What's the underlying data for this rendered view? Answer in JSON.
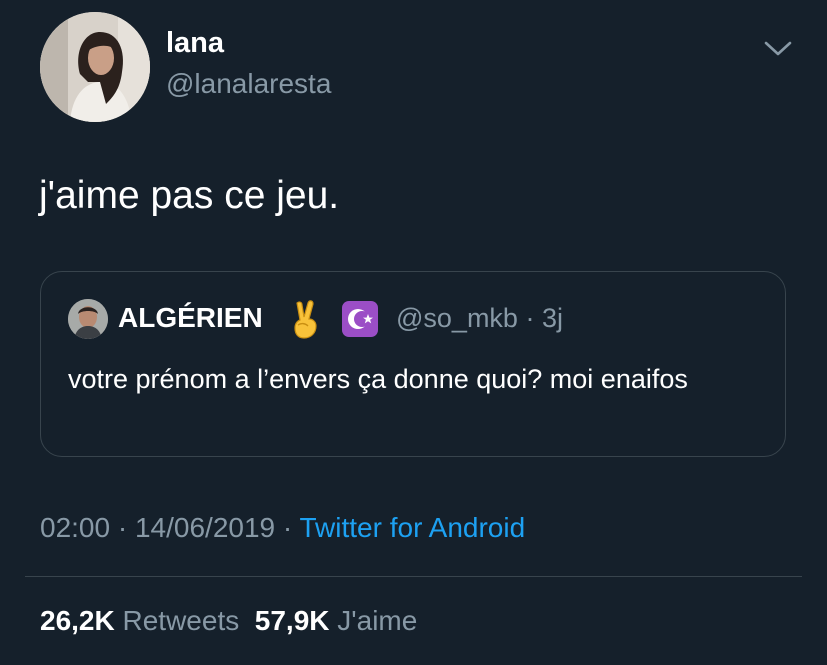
{
  "tweet": {
    "author": {
      "name": "lana",
      "handle": "@lanalaresta"
    },
    "text": "j'aime pas ce jeu.",
    "quoted": {
      "name": "ALGÉRIEN",
      "handle": "@so_mkb",
      "separator": "·",
      "age": "3j",
      "text": "votre prénom a l’envers ça donne quoi? moi enaifos",
      "emoji_1": "victory-hand-icon",
      "emoji_2": "star-and-crescent-icon"
    },
    "meta": {
      "time": "02:00",
      "separator": "·",
      "date": "14/06/2019",
      "source": "Twitter for Android"
    },
    "stats": {
      "retweets_count": "26,2K",
      "retweets_label": "Retweets",
      "likes_count": "57,9K",
      "likes_label": "J'aime"
    }
  },
  "colors": {
    "background": "#15202b",
    "secondary_text": "#8899a6",
    "link": "#1da1f2",
    "border": "#38444d",
    "badge": "#9b4ec6"
  }
}
